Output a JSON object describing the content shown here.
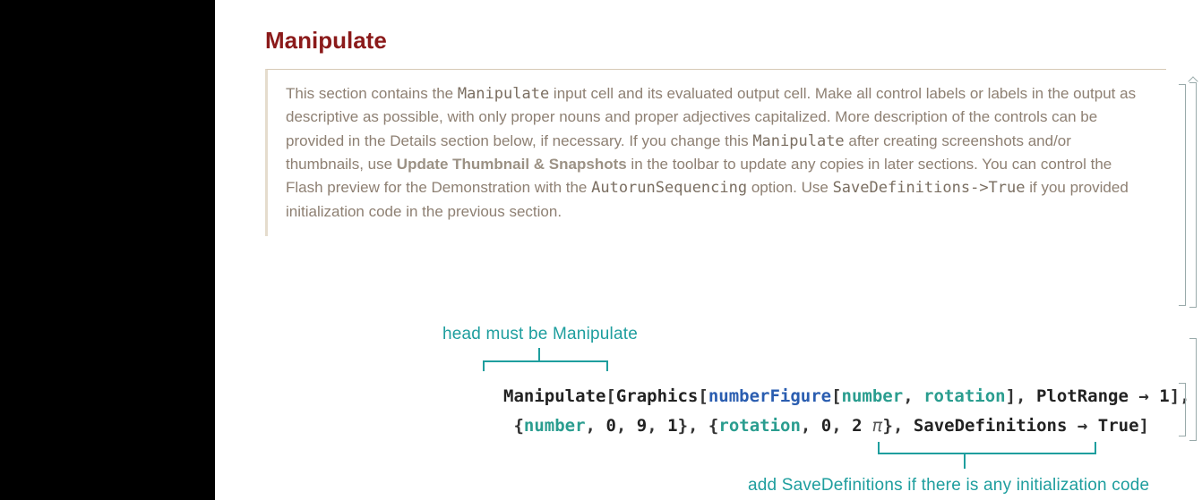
{
  "heading": "Manipulate",
  "desc": {
    "p1a": "This section contains the ",
    "p1b": "Manipulate",
    "p1c": " input cell and its evaluated output cell. Make all control labels or labels in the output as descriptive as possible, with only proper nouns and proper adjectives capitalized. More description of the controls can be provided in the Details section below, if necessary. If you change this ",
    "p1d": "Manipulate",
    "p1e": " after creating screenshots and/or thumbnails, use ",
    "p1f": "Update Thumbnail & Snapshots",
    "p1g": " in the toolbar to update any copies in later sections. You can control the Flash preview for the Demonstration with the ",
    "p1h": "AutorunSequencing",
    "p1i": " option. Use ",
    "p1j": "SaveDefinitions->True",
    "p1k": " if you provided initialization code in the previous section."
  },
  "annot": {
    "top": "head must be Manipulate",
    "bottom": "add SaveDefinitions if there is any initialization code"
  },
  "code": {
    "Manipulate": "Manipulate",
    "Graphics": "Graphics",
    "numberFigure": "numberFigure",
    "number": "number",
    "rotation": "rotation",
    "PlotRange": "PlotRange",
    "one": "1",
    "zero": "0",
    "nine": "9",
    "twoPi_2": "2",
    "twoPi_pi": "π",
    "SaveDefinitions": "SaveDefinitions",
    "True": "True",
    "arrow": "→",
    "comma": ", ",
    "open": "[",
    "close": "]",
    "lbrace": "{",
    "rbrace": "}"
  }
}
